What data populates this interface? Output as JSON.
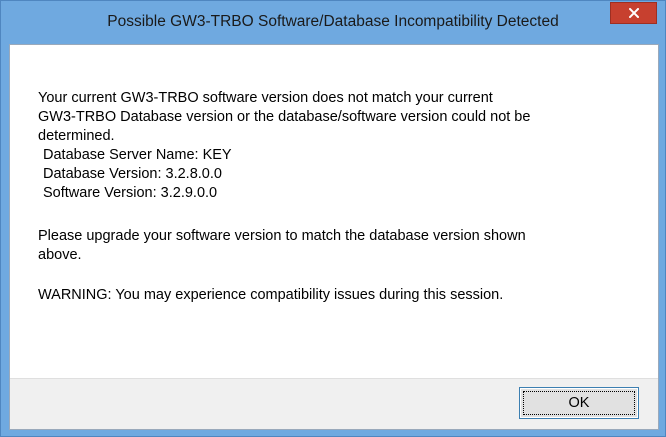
{
  "window": {
    "title": "Possible GW3-TRBO Software/Database Incompatibility Detected",
    "close_icon": "close-icon"
  },
  "message": {
    "line1": "Your current GW3-TRBO software version does not match your current",
    "line2": "GW3-TRBO Database version or the database/software version could not be",
    "line3": "determined.",
    "server_name": "Database Server Name:  KEY",
    "db_version": "Database Version:  3.2.8.0.0",
    "sw_version": "Software Version:  3.2.9.0.0",
    "upgrade_line1": "Please upgrade your software version to match the database version shown",
    "upgrade_line2": "above.",
    "warning": "WARNING:  You may experience compatibility issues during this session."
  },
  "buttons": {
    "ok_label": "OK"
  },
  "colors": {
    "title_bar": "#6fa9e0",
    "close_button": "#c7402f",
    "footer": "#f0f0f0"
  }
}
